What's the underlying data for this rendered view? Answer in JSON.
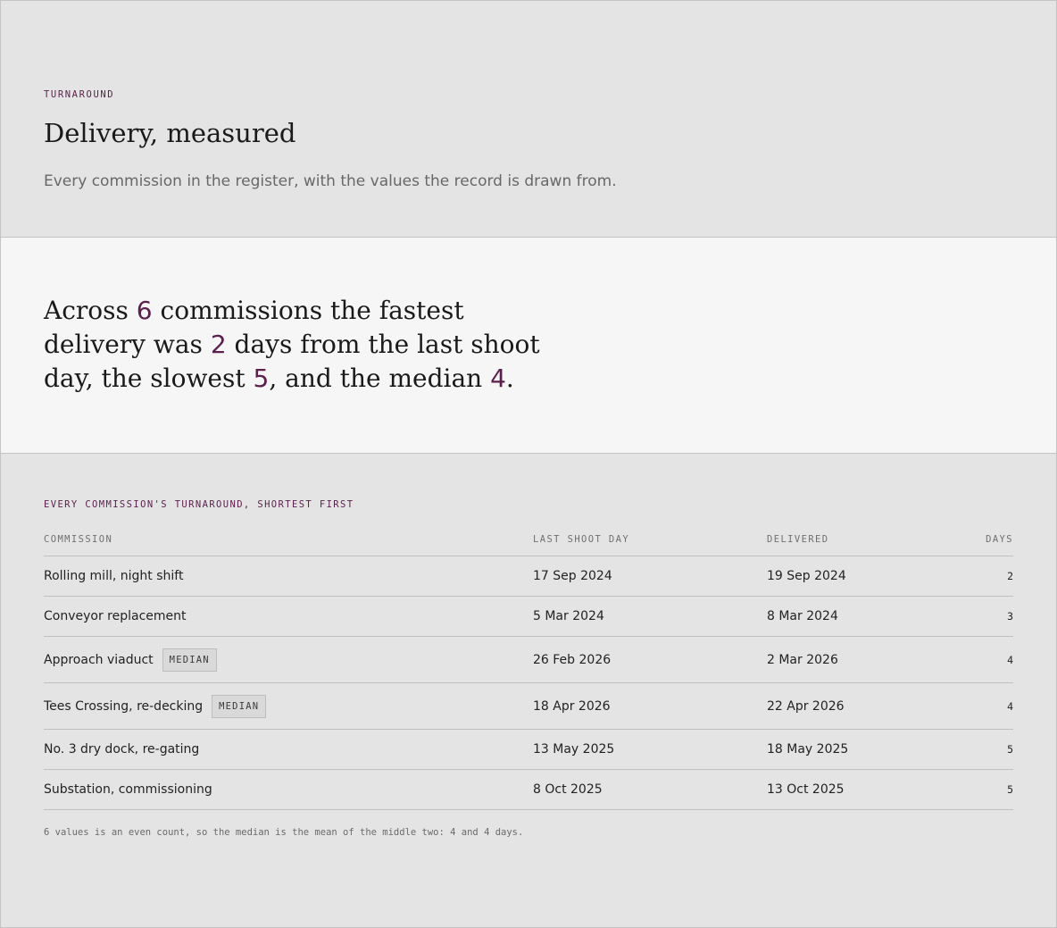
{
  "header": {
    "eyebrow": "TURNAROUND",
    "title": "Delivery, measured",
    "subtitle": "Every commission in the register, with the values the record is drawn from."
  },
  "summary": {
    "t1": "Across ",
    "count": "6",
    "t2": " commissions the fastest delivery was ",
    "fastest": "2",
    "t3": " days from the last shoot day, the slowest ",
    "slowest": "5",
    "t4": ", and the median ",
    "median": "4",
    "t5": "."
  },
  "table": {
    "caption": "EVERY COMMISSION'S TURNAROUND, SHORTEST FIRST",
    "headers": {
      "commission": "COMMISSION",
      "last_shoot": "LAST SHOOT DAY",
      "delivered": "DELIVERED",
      "days": "DAYS"
    },
    "rows": [
      {
        "commission": "Rolling mill, night shift",
        "last_shoot": "17 Sep 2024",
        "delivered": "19 Sep 2024",
        "days": "2",
        "badge": ""
      },
      {
        "commission": "Conveyor replacement",
        "last_shoot": "5 Mar 2024",
        "delivered": "8 Mar 2024",
        "days": "3",
        "badge": ""
      },
      {
        "commission": "Approach viaduct",
        "last_shoot": "26 Feb 2026",
        "delivered": "2 Mar 2026",
        "days": "4",
        "badge": "MEDIAN"
      },
      {
        "commission": "Tees Crossing, re-decking",
        "last_shoot": "18 Apr 2026",
        "delivered": "22 Apr 2026",
        "days": "4",
        "badge": "MEDIAN"
      },
      {
        "commission": "No. 3 dry dock, re-gating",
        "last_shoot": "13 May 2025",
        "delivered": "18 May 2025",
        "days": "5",
        "badge": ""
      },
      {
        "commission": "Substation, commissioning",
        "last_shoot": "8 Oct 2025",
        "delivered": "13 Oct 2025",
        "days": "5",
        "badge": ""
      }
    ],
    "footnote": "6 values is an even count, so the median is the mean of the middle two: 4 and 4 days."
  },
  "colors": {
    "accent": "#5b1f4b",
    "background": "#e4e4e4",
    "summary_background": "#f6f6f6"
  }
}
